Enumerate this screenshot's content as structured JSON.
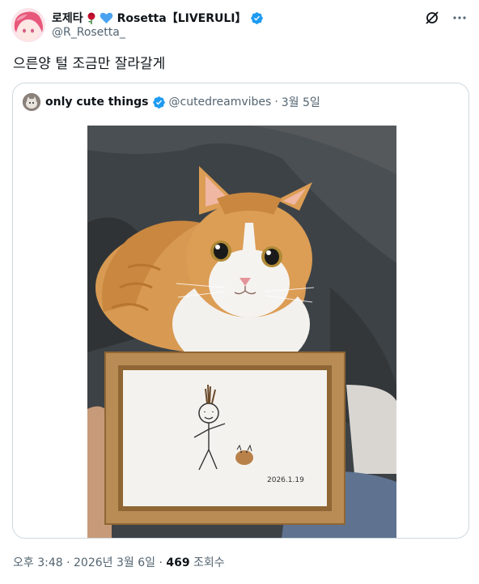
{
  "author": {
    "name_prefix": "로제타",
    "name_suffix": "Rosetta【LIVERULI】",
    "handle": "@R_Rosetta_",
    "emojis": [
      "rose-icon",
      "blue-heart-icon"
    ],
    "verified": true
  },
  "tweet": {
    "text": "으른양 털 조금만 잘라갈게"
  },
  "quote": {
    "name": "only cute things",
    "handle": "@cutedreamvibes",
    "separator": "·",
    "date": "3월 5일",
    "verified": true,
    "image": {
      "frame_date": "2026.1.19"
    }
  },
  "meta": {
    "time": "오후 3:48",
    "separator": "·",
    "date": "2026년 3월 6일",
    "views_count": "469",
    "views_label": "조회수"
  },
  "colors": {
    "verified": "#1d9bf0",
    "secondary_text": "#536471",
    "border": "#cfd9de"
  }
}
